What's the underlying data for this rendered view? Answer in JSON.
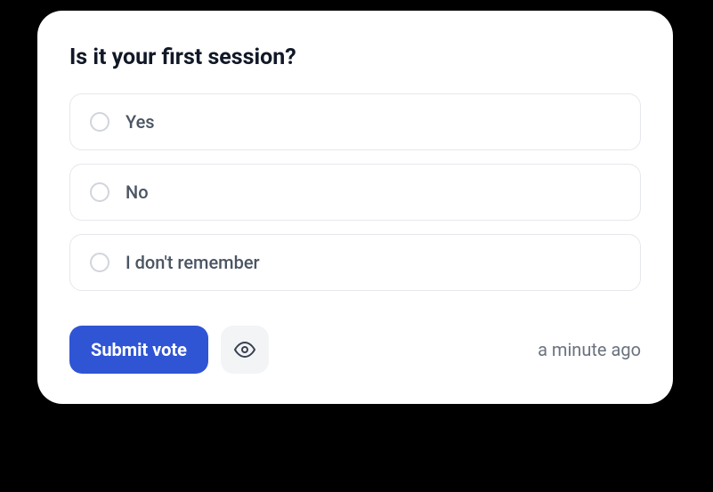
{
  "poll": {
    "question": "Is it your first session?",
    "options": [
      {
        "label": "Yes"
      },
      {
        "label": "No"
      },
      {
        "label": "I don't remember"
      }
    ],
    "submit_label": "Submit vote",
    "timestamp": "a minute ago"
  }
}
